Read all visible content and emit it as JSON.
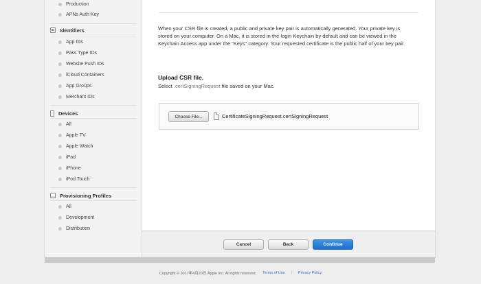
{
  "sidebar": {
    "top_items": [
      {
        "label": "Production"
      },
      {
        "label": "APNs Auth Key"
      }
    ],
    "sections": [
      {
        "title": "Identifiers",
        "icon": "id-icon",
        "icon_text": "ID",
        "items": [
          {
            "label": "App IDs"
          },
          {
            "label": "Pass Type IDs"
          },
          {
            "label": "Website Push IDs"
          },
          {
            "label": "iCloud Containers"
          },
          {
            "label": "App Groups"
          },
          {
            "label": "Merchant IDs"
          }
        ]
      },
      {
        "title": "Devices",
        "icon": "device-icon",
        "items": [
          {
            "label": "All"
          },
          {
            "label": "Apple TV"
          },
          {
            "label": "Apple Watch"
          },
          {
            "label": "iPad"
          },
          {
            "label": "iPhone"
          },
          {
            "label": "iPod Touch"
          }
        ]
      },
      {
        "title": "Provisioning Profiles",
        "icon": "profile-icon",
        "items": [
          {
            "label": "All"
          },
          {
            "label": "Development"
          },
          {
            "label": "Distribution"
          }
        ]
      }
    ]
  },
  "main": {
    "paragraph": "When your CSR file is created, a public and private key pair is automatically generated. Your private key is stored on your computer. On a Mac, it is stored in the login Keychain by default and can be viewed in the Keychain Access app under the \"Keys\" category. Your requested certificate is the public half of your key pair.",
    "upload_title": "Upload CSR file.",
    "upload_sub_prefix": "Select ",
    "upload_sub_ext": ".certSigningRequest",
    "upload_sub_suffix": " file saved on your Mac.",
    "choose_file_label": "Choose File...",
    "file_name": "CertificateSigningRequest.certSigningRequest"
  },
  "actions": {
    "cancel": "Cancel",
    "back": "Back",
    "continue": "Continue"
  },
  "footer": {
    "copyright": "Copyright © 2017年4月20日 Apple Inc. All rights reserved.",
    "terms": "Terms of Use",
    "privacy": "Privacy Policy"
  },
  "colors": {
    "accent": "#1f6fce",
    "link": "#2a6fc9"
  }
}
